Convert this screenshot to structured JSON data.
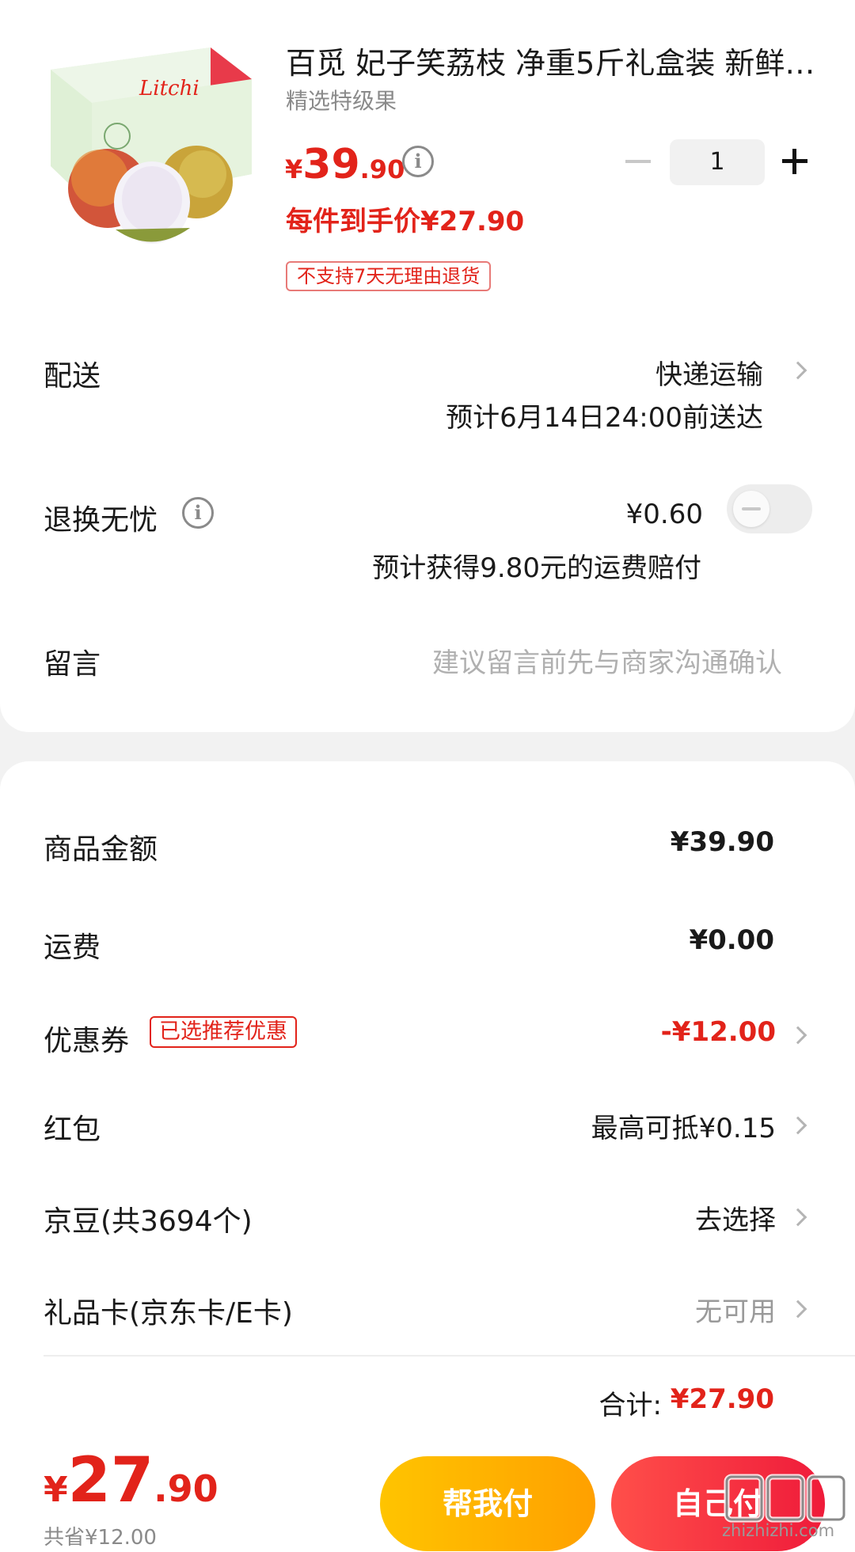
{
  "product": {
    "title": "百觅 妃子笑荔枝 净重5斤礼盒装 新鲜水果",
    "subtitle": "精选特级果",
    "price_symbol": "¥",
    "price_int": "39",
    "price_dec": ".90",
    "deal_price": "每件到手价¥27.90",
    "return_policy": "不支持7天无理由退货",
    "quantity": "1",
    "box_brand": "Litchi"
  },
  "delivery": {
    "label": "配送",
    "method": "快递运输",
    "eta": "预计6月14日24:00前送达"
  },
  "return_insurance": {
    "label": "退换无忧",
    "price": "¥0.60",
    "note": "预计获得9.80元的运费赔付",
    "enabled": false
  },
  "message": {
    "label": "留言",
    "placeholder": "建议留言前先与商家沟通确认"
  },
  "summary": {
    "goods_label": "商品金额",
    "goods_value": "¥39.90",
    "shipping_label": "运费",
    "shipping_value": "¥0.00",
    "coupon_label": "优惠券",
    "coupon_tag": "已选推荐优惠",
    "coupon_value": "-¥12.00",
    "redpacket_label": "红包",
    "redpacket_value": "最高可抵¥0.15",
    "jingdou_label": "京豆(共3694个)",
    "jingdou_value": "去选择",
    "giftcard_label": "礼品卡(京东卡/E卡)",
    "giftcard_value": "无可用",
    "total_label": "合计:",
    "total_value": "¥27.90"
  },
  "bottom_bar": {
    "price_symbol": "¥",
    "price_int": "27",
    "price_dec": ".90",
    "saved": "共省¥12.00",
    "help_pay": "帮我付",
    "self_pay": "自己付",
    "watermark": "zhizhizhi.com"
  },
  "colors": {
    "accent_red": "#e2231a",
    "button_yellow": "#ffb300",
    "button_red": "#f42a3f"
  }
}
